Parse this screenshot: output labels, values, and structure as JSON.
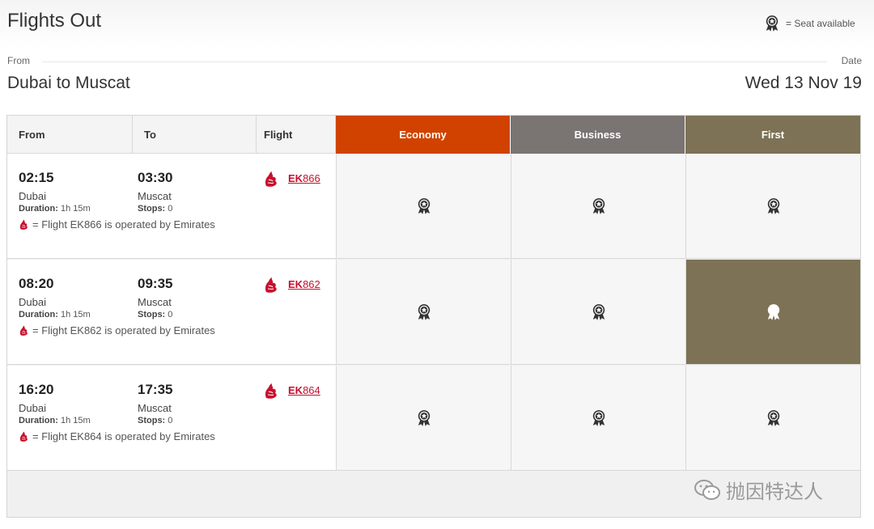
{
  "page": {
    "title": "Flights Out",
    "legend_text": "= Seat available",
    "from_label": "From",
    "date_label": "Date",
    "route": "Dubai to Muscat",
    "date": "Wed 13 Nov 19"
  },
  "colors": {
    "economy": "#d14200",
    "business": "#7a7472",
    "first": "#7d7256",
    "emirates_red": "#c8102e"
  },
  "table": {
    "headers": {
      "from": "From",
      "to": "To",
      "flight": "Flight",
      "economy": "Economy",
      "business": "Business",
      "first": "First"
    },
    "rows": [
      {
        "dep_time": "02:15",
        "dep_city": "Dubai",
        "duration_label": "Duration:",
        "duration": "1h 15m",
        "arr_time": "03:30",
        "arr_city": "Muscat",
        "stops_label": "Stops:",
        "stops": "0",
        "flight_prefix": "EK",
        "flight_number": "866",
        "operated": "= Flight EK866 is operated by Emirates"
      },
      {
        "dep_time": "08:20",
        "dep_city": "Dubai",
        "duration_label": "Duration:",
        "duration": "1h 15m",
        "arr_time": "09:35",
        "arr_city": "Muscat",
        "stops_label": "Stops:",
        "stops": "0",
        "flight_prefix": "EK",
        "flight_number": "862",
        "operated": "= Flight EK862 is operated by Emirates"
      },
      {
        "dep_time": "16:20",
        "dep_city": "Dubai",
        "duration_label": "Duration:",
        "duration": "1h 15m",
        "arr_time": "17:35",
        "arr_city": "Muscat",
        "stops_label": "Stops:",
        "stops": "0",
        "flight_prefix": "EK",
        "flight_number": "864",
        "operated": "= Flight EK864 is operated by Emirates"
      }
    ],
    "selected_cell": "row 2 first class"
  },
  "icons": {
    "seat": "seat-available-icon",
    "airline": "emirates-logo-icon",
    "watermark": "wechat-icon"
  },
  "watermark": "抛因特达人"
}
